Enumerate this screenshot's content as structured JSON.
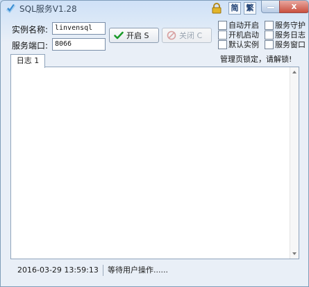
{
  "window": {
    "title": "SQL服务V1.28",
    "close_glyph": "x"
  },
  "ime": {
    "simplified": "简",
    "traditional": "繁"
  },
  "form": {
    "instance_label": "实例名称:",
    "instance_value": "linvensql",
    "port_label": "服务端口:",
    "port_value": "8066"
  },
  "buttons": {
    "start_label": "开启 S",
    "stop_label": "关闭 C"
  },
  "options": {
    "auto_start": "自动开启",
    "service_guard": "服务守护",
    "boot_start": "开机启动",
    "service_log": "服务日志",
    "default_instance": "默认实例",
    "service_window": "服务窗口"
  },
  "notice": "管理页锁定，请解锁!",
  "tabs": [
    {
      "label": "日志 1"
    }
  ],
  "status": {
    "datetime": "2016-03-29 13:59:13",
    "message": "等待用户操作......"
  },
  "colors": {
    "accent": "#1d3f73",
    "start_check": "#1a9a2a",
    "stop_icon": "#d8a0a0"
  }
}
